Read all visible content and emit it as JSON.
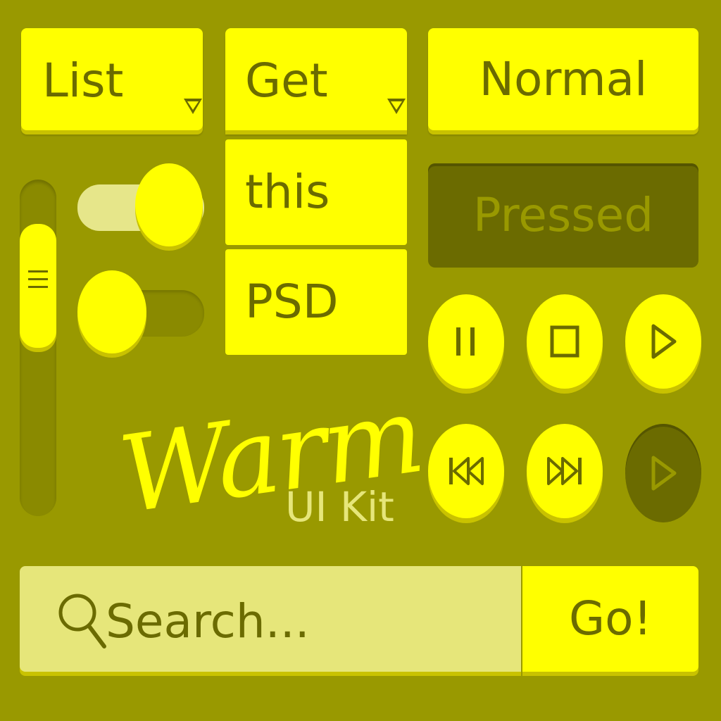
{
  "dropdown_list": {
    "label": "List",
    "arrow_icon": "triangle-down-icon"
  },
  "dropdown_get": {
    "label": "Get",
    "arrow_icon": "triangle-down-icon",
    "options": [
      "this",
      "PSD"
    ]
  },
  "buttons": {
    "normal_label": "Normal",
    "pressed_label": "Pressed"
  },
  "media_controls": {
    "row1": [
      {
        "name": "pause",
        "icon": "pause-icon"
      },
      {
        "name": "stop",
        "icon": "stop-icon"
      },
      {
        "name": "play",
        "icon": "play-icon"
      }
    ],
    "row2": [
      {
        "name": "previous",
        "icon": "skip-back-icon"
      },
      {
        "name": "next",
        "icon": "skip-forward-icon"
      },
      {
        "name": "play-disabled",
        "icon": "play-icon"
      }
    ]
  },
  "slider": {
    "grip_icon": "grip-lines-icon"
  },
  "toggles": [
    {
      "name": "toggle-on",
      "state": "on"
    },
    {
      "name": "toggle-off",
      "state": "off"
    }
  ],
  "branding": {
    "title": "Warm",
    "subtitle": "UI Kit"
  },
  "search": {
    "placeholder": "Search...",
    "icon": "search-icon",
    "go_label": "Go!"
  },
  "colors": {
    "background": "#999900",
    "accent": "#ffff00",
    "dark": "#6b6b00",
    "muted": "#e6e67a"
  }
}
